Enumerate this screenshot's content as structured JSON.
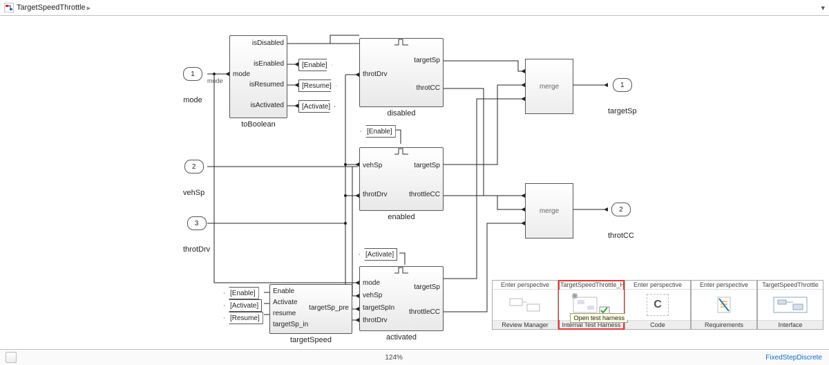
{
  "breadcrumb": {
    "title": "TargetSpeedThrottle"
  },
  "inports": {
    "mode": {
      "num": "1",
      "label": "mode"
    },
    "vehSp": {
      "num": "2",
      "label": "vehSp"
    },
    "throtDrv": {
      "num": "3",
      "label": "throtDrv"
    }
  },
  "outports": {
    "targetSp": {
      "num": "1",
      "label": "targetSp"
    },
    "throtCC": {
      "num": "2",
      "label": "throtCC"
    }
  },
  "blocks": {
    "toBoolean": {
      "title": "toBoolean",
      "in": [
        "mode"
      ],
      "out": [
        "isDisabled",
        "isEnabled",
        "isResumed",
        "isActivated"
      ]
    },
    "disabled": {
      "title": "disabled",
      "in": [
        "throtDrv"
      ],
      "out": [
        "targetSp",
        "throtCC"
      ]
    },
    "enabled": {
      "title": "enabled",
      "in": [
        "vehSp",
        "throtDrv"
      ],
      "out": [
        "targetSp",
        "throttleCC"
      ]
    },
    "activated": {
      "title": "activated",
      "in": [
        "mode",
        "vehSp",
        "targetSpIn",
        "throtDrv"
      ],
      "out": [
        "targetSp",
        "throttleCC"
      ]
    },
    "targetSpeed": {
      "title": "targetSpeed",
      "in": [
        "Enable",
        "Activate",
        "resume",
        "targetSp_in"
      ],
      "out": [
        "targetSp_pre"
      ]
    }
  },
  "merges": {
    "m1": "merge",
    "m2": "merge"
  },
  "gotoTags": {
    "enable": "[Enable]",
    "resume": "[Resume]",
    "activate": "[Activate]"
  },
  "fromTags": {
    "enable": "[Enable]",
    "activate": "[Activate]",
    "resume": "[Resume]",
    "enableIn": "[Enable]",
    "activateIn": "[Activate]"
  },
  "signalLbl": {
    "modePort": "mode"
  },
  "perspectives": {
    "review": {
      "hdr": "Enter perspective",
      "ftr": "Review Manager"
    },
    "harness": {
      "hdr": "TargetSpeedThrottle_Harness",
      "ftr": "Internal Test Harness",
      "tooltip": "Open test harness"
    },
    "code": {
      "hdr": "Enter perspective",
      "ftr": "Code",
      "glyph": "C"
    },
    "req": {
      "hdr": "Enter perspective",
      "ftr": "Requirements"
    },
    "interface": {
      "hdr": "TargetSpeedThrottle",
      "ftr": "Interface"
    }
  },
  "footer": {
    "zoom": "124%",
    "solver": "FixedStepDiscrete"
  }
}
